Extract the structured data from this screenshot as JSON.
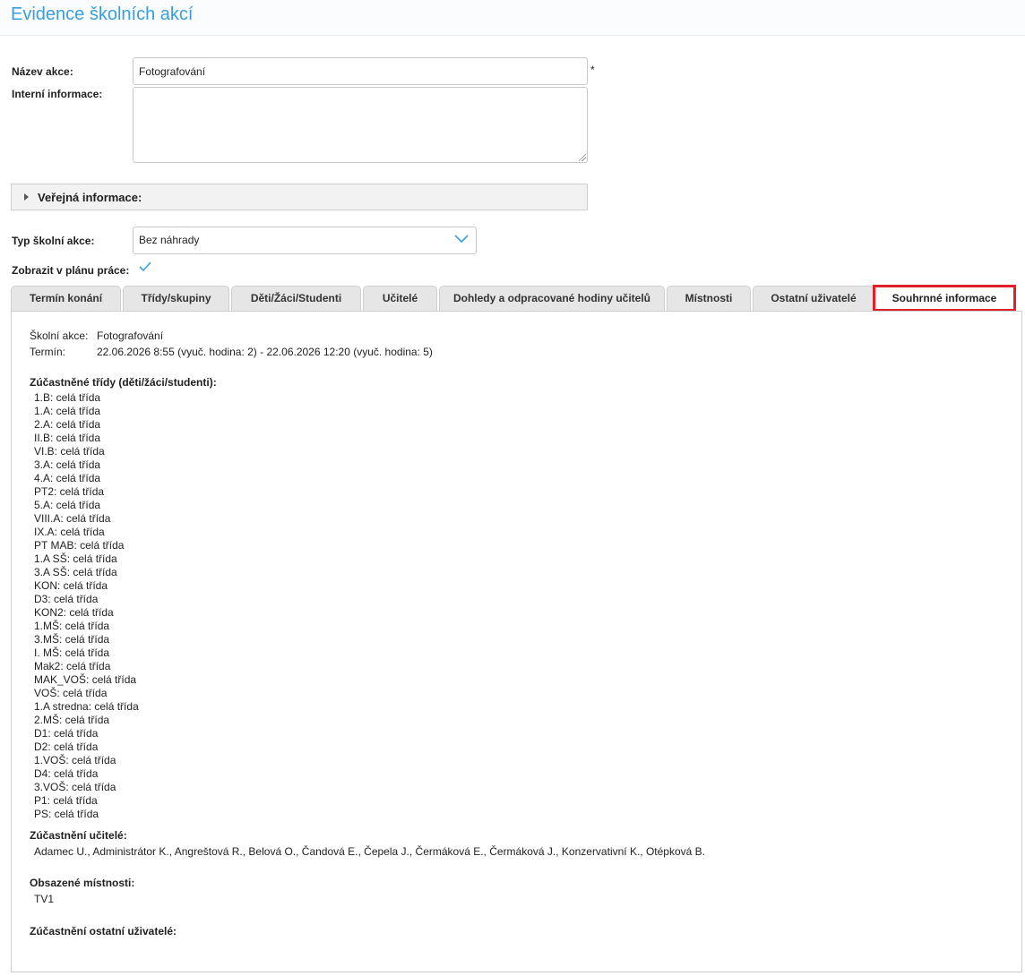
{
  "header": {
    "title": "Evidence školních akcí"
  },
  "form": {
    "name_label": "Název akce:",
    "name_value": "Fotografování",
    "required_mark": "*",
    "internal_label": "Interní informace:",
    "internal_value": "",
    "public_info_label": "Veřejná informace:",
    "type_label": "Typ školní akce:",
    "type_value": "Bez náhrady",
    "show_in_plan_label": "Zobrazit v plánu práce:",
    "show_in_plan_checked": true
  },
  "tabs": [
    {
      "label": "Termín konání"
    },
    {
      "label": "Třídy/skupiny"
    },
    {
      "label": "Děti/Žáci/Studenti"
    },
    {
      "label": "Učitelé"
    },
    {
      "label": "Dohledy a odpracované hodiny učitelů"
    },
    {
      "label": "Místnosti"
    },
    {
      "label": "Ostatní uživatelé"
    },
    {
      "label": "Souhrnné informace",
      "active": true
    }
  ],
  "summary": {
    "action_label": "Školní akce:",
    "action_value": "Fotografování",
    "term_label": "Termín:",
    "term_value": "22.06.2026 8:55 (vyuč. hodina: 2) - 22.06.2026 12:20 (vyuč. hodina: 5)",
    "classes_title": "Zúčastněné třídy (děti/žáci/studenti):",
    "classes": [
      "1.B: celá třída",
      "1.A: celá třída",
      "2.A: celá třída",
      "II.B: celá třída",
      "VI.B: celá třída",
      "3.A: celá třída",
      "4.A: celá třída",
      "PT2: celá třída",
      "5.A: celá třída",
      "VIII.A: celá třída",
      "IX.A: celá třída",
      "PT MAB: celá třída",
      "1.A SŠ: celá třída",
      "3.A SŠ: celá třída",
      "KON: celá třída",
      "D3: celá třída",
      "KON2: celá třída",
      "1.MŠ: celá třída",
      "3.MŠ: celá třída",
      "I. MŠ: celá třída",
      "Mak2: celá třída",
      "MAK_VOŠ: celá třída",
      "VOŠ: celá třída",
      "1.A stredna: celá třída",
      "2.MŠ: celá třída",
      "D1: celá třída",
      "D2: celá třída",
      "1.VOŠ: celá třída",
      "D4: celá třída",
      "3.VOŠ: celá třída",
      "P1: celá třída",
      "PS: celá třída"
    ],
    "teachers_title": "Zúčastnění učitelé:",
    "teachers_value": "Adamec U., Administrátor K., Angreštová R., Belová O., Čandová E., Čepela J., Čermáková E., Čermáková J., Konzervativní K., Otépková B.",
    "rooms_title": "Obsazené místnosti:",
    "rooms_value": "TV1",
    "others_title": "Zúčastnění ostatní uživatelé:"
  },
  "colors": {
    "title_blue": "#3a9fd8",
    "highlight_red": "#e0202a",
    "check_blue": "#3a9fd8"
  }
}
